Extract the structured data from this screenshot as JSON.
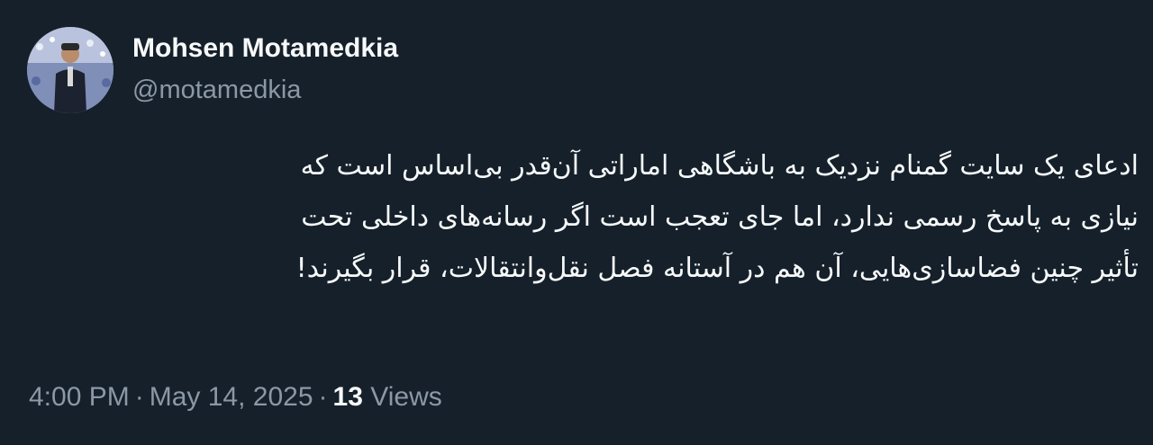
{
  "author": {
    "display_name": "Mohsen Motamedkia",
    "handle": "@motamedkia",
    "avatar_icon": "profile-photo"
  },
  "tweet": {
    "lines": [
      "ادعای یک سایت گمنام نزدیک به باشگاهی اماراتی آن‌قدر بی‌اساس است که",
      "نیازی به پاسخ رسمی ندارد، اما جای تعجب است اگر رسانه‌های داخلی تحت",
      "تأثیر چنین فضاسازی‌هایی، آن هم در آستانه فصل نقل‌وانتقالات، قرار بگیرند!"
    ]
  },
  "meta": {
    "time": "4:00 PM",
    "separator": "·",
    "date": "May 14, 2025",
    "views_count": "13",
    "views_label": "Views"
  },
  "colors": {
    "background": "#15202b",
    "primary_text": "#f7f9f9",
    "secondary_text": "#8b98a5"
  }
}
